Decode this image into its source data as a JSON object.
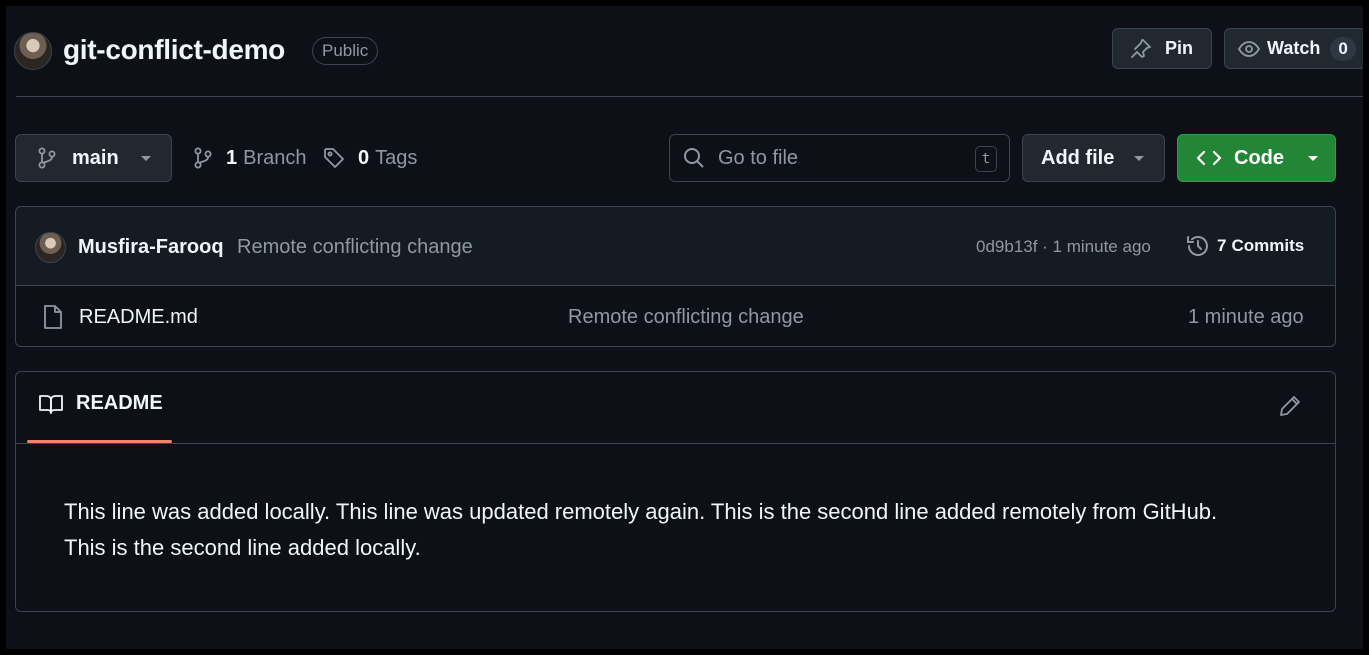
{
  "repo": {
    "name": "git-conflict-demo",
    "visibility": "Public"
  },
  "header_actions": {
    "pin_label": "Pin",
    "watch_label": "Watch",
    "watch_count": "0"
  },
  "toolbar": {
    "branch": "main",
    "branches_count": "1",
    "branches_label": "Branch",
    "tags_count": "0",
    "tags_label": "Tags",
    "search_placeholder": "Go to file",
    "search_shortcut": "t",
    "add_file_label": "Add file",
    "code_label": "Code"
  },
  "latest_commit": {
    "author": "Musfira-Farooq",
    "message": "Remote conflicting change",
    "meta": "0d9b13f · 1 minute ago",
    "commits_count": "7",
    "commits_label": "Commits"
  },
  "files": [
    {
      "name": "README.md",
      "message": "Remote conflicting change",
      "time": "1 minute ago"
    }
  ],
  "readme": {
    "tab_label": "README",
    "content": "This line was added locally. This line was updated remotely again. This is the second line added remotely from GitHub. This is the second line added locally."
  },
  "colors": {
    "background": "#0d1117",
    "border": "#3d444d",
    "button_bg": "#212830",
    "primary_green": "#238636",
    "tab_underline": "#f78166",
    "muted_text": "#9198a1"
  },
  "icons": [
    "avatar",
    "pin-icon",
    "eye-icon",
    "branch-icon",
    "tag-icon",
    "search-icon",
    "chevron-down-icon",
    "code-icon",
    "history-icon",
    "file-icon",
    "book-icon",
    "pencil-icon"
  ]
}
